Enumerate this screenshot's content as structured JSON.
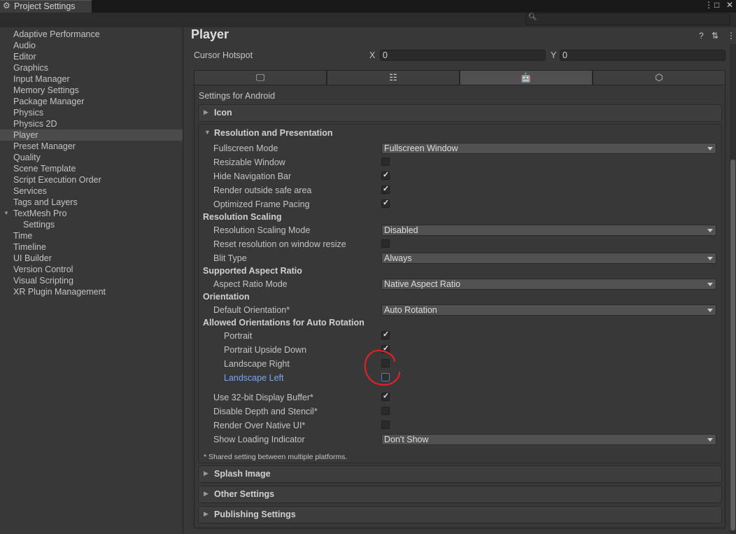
{
  "window": {
    "tab_title": "Project Settings",
    "tab_icon": "gear-icon",
    "controls": [
      "⋮",
      "□",
      "✕"
    ]
  },
  "search": {
    "placeholder": ""
  },
  "sidebar": {
    "items": [
      {
        "label": "Adaptive Performance"
      },
      {
        "label": "Audio"
      },
      {
        "label": "Editor"
      },
      {
        "label": "Graphics"
      },
      {
        "label": "Input Manager"
      },
      {
        "label": "Memory Settings"
      },
      {
        "label": "Package Manager"
      },
      {
        "label": "Physics"
      },
      {
        "label": "Physics 2D"
      },
      {
        "label": "Player",
        "selected": true
      },
      {
        "label": "Preset Manager"
      },
      {
        "label": "Quality"
      },
      {
        "label": "Scene Template"
      },
      {
        "label": "Script Execution Order"
      },
      {
        "label": "Services"
      },
      {
        "label": "Tags and Layers"
      },
      {
        "label": "TextMesh Pro",
        "expanded": true
      },
      {
        "label": "Settings",
        "child": true
      },
      {
        "label": "Time"
      },
      {
        "label": "Timeline"
      },
      {
        "label": "UI Builder"
      },
      {
        "label": "Version Control"
      },
      {
        "label": "Visual Scripting"
      },
      {
        "label": "XR Plugin Management"
      }
    ]
  },
  "main": {
    "title": "Player",
    "header_icons": [
      "help-icon",
      "preset-icon",
      "more-icon"
    ],
    "cursor_hotspot": {
      "label": "Cursor Hotspot",
      "x_label": "X",
      "x_value": "0",
      "y_label": "Y",
      "y_value": "0"
    },
    "platform_tabs": [
      {
        "icon": "desktop-icon",
        "glyph": "🖵",
        "active": false
      },
      {
        "icon": "server-icon",
        "glyph": "☷",
        "active": false
      },
      {
        "icon": "android-icon",
        "glyph": "🤖",
        "active": true
      },
      {
        "icon": "html5-icon",
        "glyph": "⬡",
        "active": false
      }
    ],
    "settings_for": "Settings for Android",
    "icon_section": "Icon",
    "resolution_section": {
      "title": "Resolution and Presentation",
      "fullscreen_mode": {
        "label": "Fullscreen Mode",
        "value": "Fullscreen Window"
      },
      "resizable_window": {
        "label": "Resizable Window",
        "checked": false
      },
      "hide_navigation_bar": {
        "label": "Hide Navigation Bar",
        "checked": true
      },
      "render_outside_safe_area": {
        "label": "Render outside safe area",
        "checked": true
      },
      "optimized_frame_pacing": {
        "label": "Optimized Frame Pacing",
        "checked": true
      },
      "resolution_scaling_header": "Resolution Scaling",
      "resolution_scaling_mode": {
        "label": "Resolution Scaling Mode",
        "value": "Disabled"
      },
      "reset_resolution": {
        "label": "Reset resolution on window resize",
        "checked": false
      },
      "blit_type": {
        "label": "Blit Type",
        "value": "Always"
      },
      "supported_aspect_header": "Supported Aspect Ratio",
      "aspect_ratio_mode": {
        "label": "Aspect Ratio Mode",
        "value": "Native Aspect Ratio"
      },
      "orientation_header": "Orientation",
      "default_orientation": {
        "label": "Default Orientation*",
        "value": "Auto Rotation"
      },
      "allowed_orientations_header": "Allowed Orientations for Auto Rotation",
      "portrait": {
        "label": "Portrait",
        "checked": true
      },
      "portrait_upside_down": {
        "label": "Portrait Upside Down",
        "checked": true
      },
      "landscape_right": {
        "label": "Landscape Right",
        "checked": false
      },
      "landscape_left": {
        "label": "Landscape Left",
        "checked": false,
        "focused": true
      },
      "use_32bit_buffer": {
        "label": "Use 32-bit Display Buffer*",
        "checked": true
      },
      "disable_depth_stencil": {
        "label": "Disable Depth and Stencil*",
        "checked": false
      },
      "render_over_native_ui": {
        "label": "Render Over Native UI*",
        "checked": false
      },
      "show_loading_indicator": {
        "label": "Show Loading Indicator",
        "value": "Don't Show"
      },
      "shared_note": "* Shared setting between multiple platforms."
    },
    "splash_section": "Splash Image",
    "other_section": "Other Settings",
    "publishing_section": "Publishing Settings"
  },
  "colors": {
    "background": "#383838",
    "focused_label": "#7aa7ea",
    "annotation_circle": "#e0202a"
  }
}
